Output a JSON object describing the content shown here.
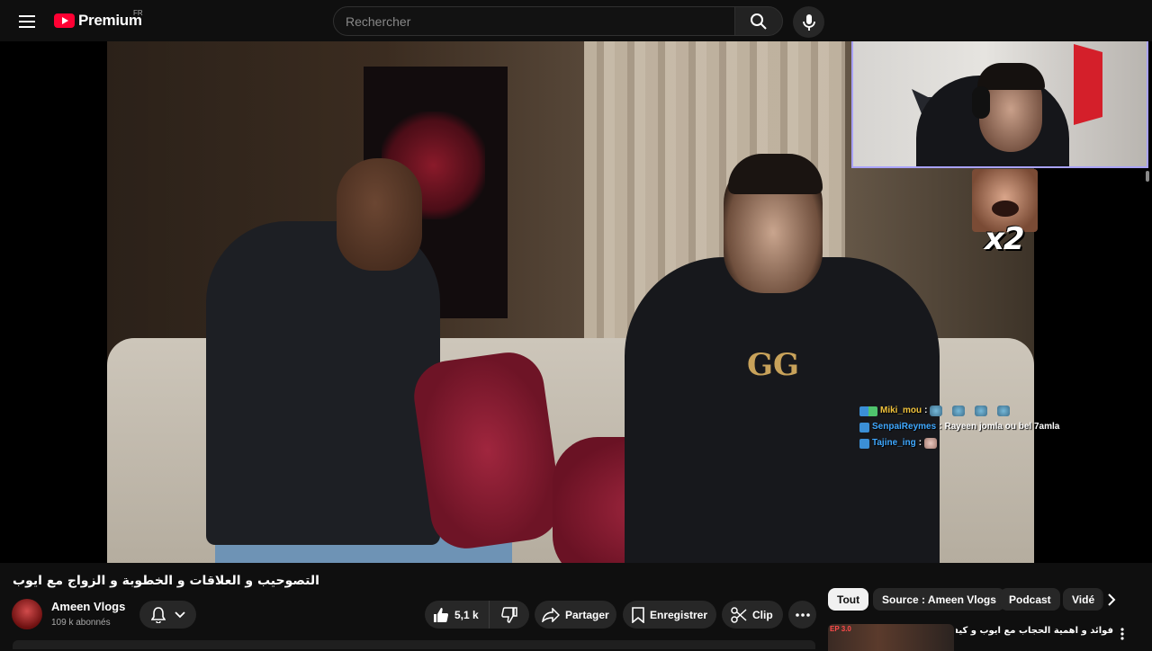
{
  "header": {
    "logo_text": "Premium",
    "region_code": "FR",
    "search_placeholder": "Rechercher"
  },
  "stream_overlay": {
    "emote_multiplier": "x2",
    "chat": [
      {
        "user": "Miki_mou",
        "user_color": "#f0c23b",
        "message": "",
        "emote_count": 4
      },
      {
        "user": "SenpaiReymes",
        "user_color": "#3fa8ff",
        "message": "Rayeen jomla ou bel 7amla"
      },
      {
        "user": "Tajine_ing",
        "user_color": "#3fa8ff",
        "message": ""
      }
    ],
    "separator": ":"
  },
  "video": {
    "title": "التصوحيب و العلاقات و الخطوبة و الزواج مع ايوب",
    "shirt_logo": "GG",
    "channel_name": "Ameen Vlogs",
    "subscribers": "109 k abonnés",
    "likes": "5,1 k",
    "share_label": "Partager",
    "save_label": "Enregistrer",
    "clip_label": "Clip"
  },
  "chips": [
    {
      "label": "Tout",
      "active": true
    },
    {
      "label": "Source : Ameen Vlogs",
      "active": false
    },
    {
      "label": "Podcast",
      "active": false
    },
    {
      "label": "Vidé",
      "active": false
    }
  ],
  "recommendation": {
    "badge": "EP 3.0",
    "title": "فوائد و اهمية الحجاب مع ايوب و كيفاش تحمي الحرف"
  },
  "colors": {
    "brand_red": "#ff0033",
    "background": "#0f0f0f",
    "button_bg": "#272727",
    "cam_border": "#a9a2ff"
  }
}
